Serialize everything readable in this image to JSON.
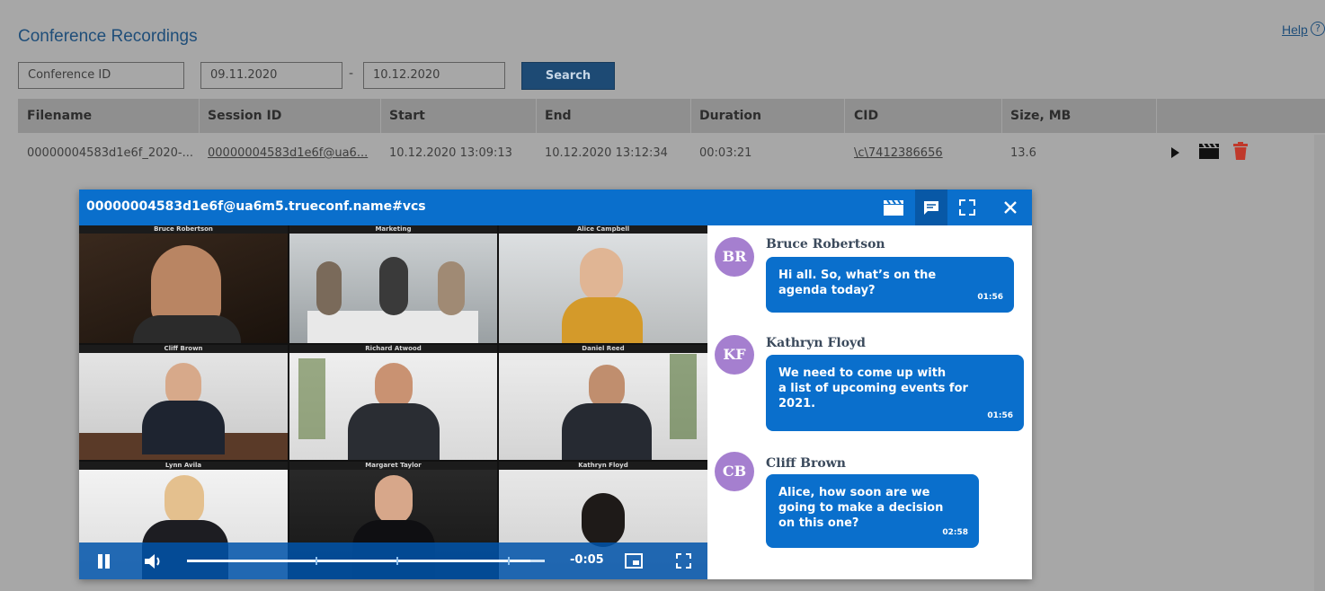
{
  "page": {
    "title": "Conference Recordings",
    "help_label": "Help",
    "help_icon": "question-circle-icon"
  },
  "filters": {
    "conference_id_placeholder": "Conference ID",
    "date_from": "09.11.2020",
    "date_separator": "-",
    "date_to": "10.12.2020",
    "search_label": "Search"
  },
  "table": {
    "columns": [
      "Filename",
      "Session ID",
      "Start",
      "End",
      "Duration",
      "CID",
      "Size, MB"
    ],
    "rows": [
      {
        "filename": "00000004583d1e6f_2020-...",
        "session_id": "00000004583d1e6f@ua6...",
        "start": "10.12.2020 13:09:13",
        "end": "10.12.2020 13:12:34",
        "duration": "00:03:21",
        "cid": "\\c\\7412386656",
        "size": "13.6",
        "actions": [
          "play-icon",
          "clapperboard-icon",
          "trash-icon"
        ]
      }
    ]
  },
  "player": {
    "title": "00000004583d1e6f@ua6m5.trueconf.name#vcs",
    "header_icons": [
      "clapperboard-icon",
      "chat-icon",
      "fullscreen-icon",
      "close-icon"
    ],
    "tiles": [
      "Bruce Robertson",
      "Marketing",
      "Alice Campbell",
      "Cliff Brown",
      "Richard Atwood",
      "Daniel Reed",
      "Lynn Avila",
      "Margaret Taylor",
      "Kathryn Floyd"
    ],
    "time_remaining": "-0:05",
    "progress": 0.96,
    "control_icons": [
      "pause-icon",
      "volume-icon",
      "picture-in-picture-icon",
      "fullscreen-icon"
    ]
  },
  "chat": {
    "messages": [
      {
        "initials": "BR",
        "author": "Bruce Robertson",
        "text": [
          "Hi all. So, what’s on the",
          "agenda today?"
        ],
        "time": "01:56"
      },
      {
        "initials": "KF",
        "author": "Kathryn Floyd",
        "text": [
          "We need to come up with",
          "a list of upcoming events for",
          "2021."
        ],
        "time": "01:56"
      },
      {
        "initials": "CB",
        "author": "Cliff Brown",
        "text": [
          "Alice, how soon are we",
          "going to make a decision",
          "on this one?"
        ],
        "time": "02:58"
      }
    ]
  },
  "colors": {
    "accent": "#0a6fcc",
    "overlay": "#a7a7a7",
    "avatar": "#a57fcf",
    "delete": "#c0392b"
  }
}
